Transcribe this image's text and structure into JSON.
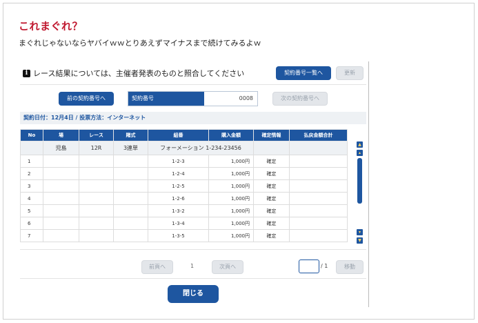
{
  "post": {
    "title": "これまぐれ？",
    "subtitle": "まぐれじゃないならヤバイｗｗとりあえずマイナスまで続けてみるよｗ"
  },
  "screen": {
    "notice": "レース結果については、主催者発表のものと照合してください",
    "buttons": {
      "contract_list": "契約番号一覧へ",
      "update": "更新",
      "prev_contract": "前の契約番号へ",
      "next_contract": "次の契約番号へ",
      "prev_page": "前頁へ",
      "next_page": "次頁へ",
      "move": "移動",
      "close": "閉じる"
    },
    "contract": {
      "label": "契約番号",
      "value": "0008"
    },
    "meta": "契約日付：12月4日 / 投票方法：インターネット",
    "table": {
      "headers": [
        "No",
        "場",
        "レース",
        "賭式",
        "組番",
        "購入金額",
        "確定情報",
        "払戻金額合計"
      ],
      "summary": {
        "venue": "児島",
        "race": "12R",
        "bet_type": "3連単",
        "method": "フォーメーション",
        "numbers": "1-234-23456"
      },
      "rows": [
        {
          "no": "1",
          "combo": "1-2-3",
          "amount": "1,000円",
          "status": "確定"
        },
        {
          "no": "2",
          "combo": "1-2-4",
          "amount": "1,000円",
          "status": "確定"
        },
        {
          "no": "3",
          "combo": "1-2-5",
          "amount": "1,000円",
          "status": "確定"
        },
        {
          "no": "4",
          "combo": "1-2-6",
          "amount": "1,000円",
          "status": "確定"
        },
        {
          "no": "5",
          "combo": "1-3-2",
          "amount": "1,000円",
          "status": "確定"
        },
        {
          "no": "6",
          "combo": "1-3-4",
          "amount": "1,000円",
          "status": "確定"
        },
        {
          "no": "7",
          "combo": "1-3-5",
          "amount": "1,000円",
          "status": "確定"
        }
      ]
    },
    "pager": {
      "current": "1",
      "total": "/ 1"
    }
  }
}
